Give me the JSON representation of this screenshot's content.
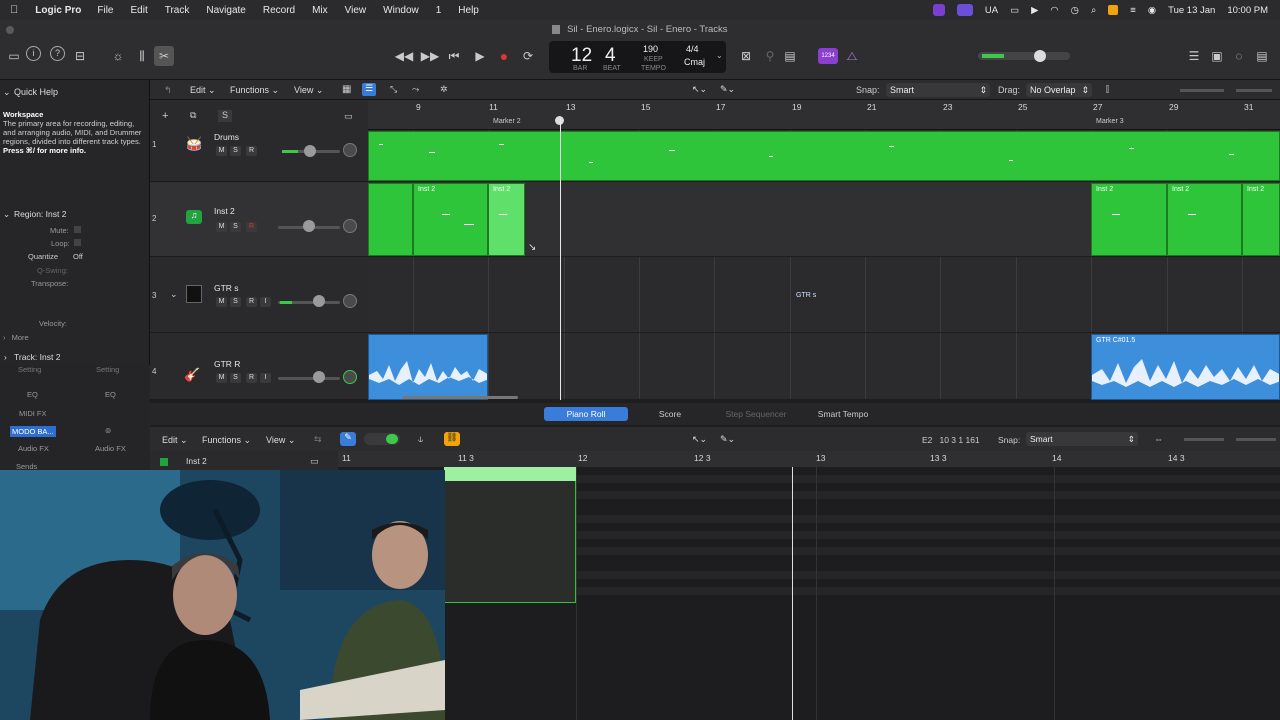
{
  "menubar": {
    "apple": "",
    "app": "Logic Pro",
    "items": [
      "File",
      "Edit",
      "Track",
      "Navigate",
      "Record",
      "Mix",
      "View",
      "Window",
      "1",
      "Help"
    ],
    "status": {
      "input": "UA",
      "date": "Tue 13 Jan",
      "time": "10:00 PM"
    }
  },
  "window": {
    "title": "Sil - Enero.logicx - Sil - Enero - Tracks"
  },
  "lcd": {
    "bar": "12",
    "beat": "4",
    "bar_label": "BAR",
    "beat_label": "BEAT",
    "tempo": "190",
    "tempo_keep": "KEEP",
    "tempo_label": "TEMPO",
    "signature": "4/4",
    "key": "Cmaj"
  },
  "toolbar": {
    "count_in": "1234"
  },
  "quickhelp": {
    "title": "Quick Help",
    "heading": "Workspace",
    "body": "The primary area for recording, editing, and arranging audio, MIDI, and Drummer regions, divided into different track types.",
    "more": "Press ⌘/ for more info."
  },
  "region_inspector": {
    "title": "Region: Inst 2",
    "mute": "Mute:",
    "loop": "Loop:",
    "quantize": "Quantize",
    "quantize_value": "Off",
    "qswing": "Q-Swing:",
    "transpose": "Transpose:",
    "velocity": "Velocity:",
    "more": "More"
  },
  "track_inspector": {
    "title": "Track: Inst 2",
    "setting1": "Setting",
    "setting2": "Setting",
    "eq1": "EQ",
    "eq2": "EQ",
    "midi_fx": "MIDI FX",
    "plugin": "MODO BA...",
    "audio_fx1": "Audio FX",
    "audio_fx2": "Audio FX",
    "sends": "Sends"
  },
  "arrange_menu": {
    "edit": "Edit",
    "functions": "Functions",
    "view": "View",
    "snap_label": "Snap:",
    "snap_value": "Smart",
    "drag_label": "Drag:",
    "drag_value": "No Overlap"
  },
  "ruler": {
    "bars": [
      "9",
      "11",
      "13",
      "15",
      "17",
      "19",
      "21",
      "23",
      "25",
      "27",
      "29",
      "31"
    ],
    "markers": [
      "Marker 2",
      "Marker 3"
    ]
  },
  "tracks": [
    {
      "number": "1",
      "name": "Drums",
      "m": "M",
      "s": "S",
      "r": "R"
    },
    {
      "number": "2",
      "name": "Inst 2",
      "m": "M",
      "s": "S",
      "r": "R"
    },
    {
      "number": "3",
      "name": "GTR s",
      "m": "M",
      "s": "S",
      "r": "R",
      "i": "I"
    },
    {
      "number": "4",
      "name": "GTR R",
      "m": "M",
      "s": "S",
      "r": "R",
      "i": "I"
    }
  ],
  "regions": {
    "inst2": "Inst 2",
    "gtrs": "GTR s",
    "gtr_audio": "GTR C#01.5"
  },
  "editor_tabs": [
    "Piano Roll",
    "Score",
    "Step Sequencer",
    "Smart Tempo"
  ],
  "editor_menu": {
    "edit": "Edit",
    "functions": "Functions",
    "view": "View",
    "position": "E2   10 3 1 161",
    "snap_label": "Snap:",
    "snap_value": "Smart",
    "track_name": "Inst 2"
  },
  "piano_ruler": [
    "11",
    "11 3",
    "12",
    "12 3",
    "13",
    "13 3",
    "14",
    "14 3"
  ],
  "colors": {
    "midi_region": "#2fc53a",
    "audio_region": "#3d8edb",
    "record": "#e0352f",
    "accent": "#3a7cd9"
  }
}
